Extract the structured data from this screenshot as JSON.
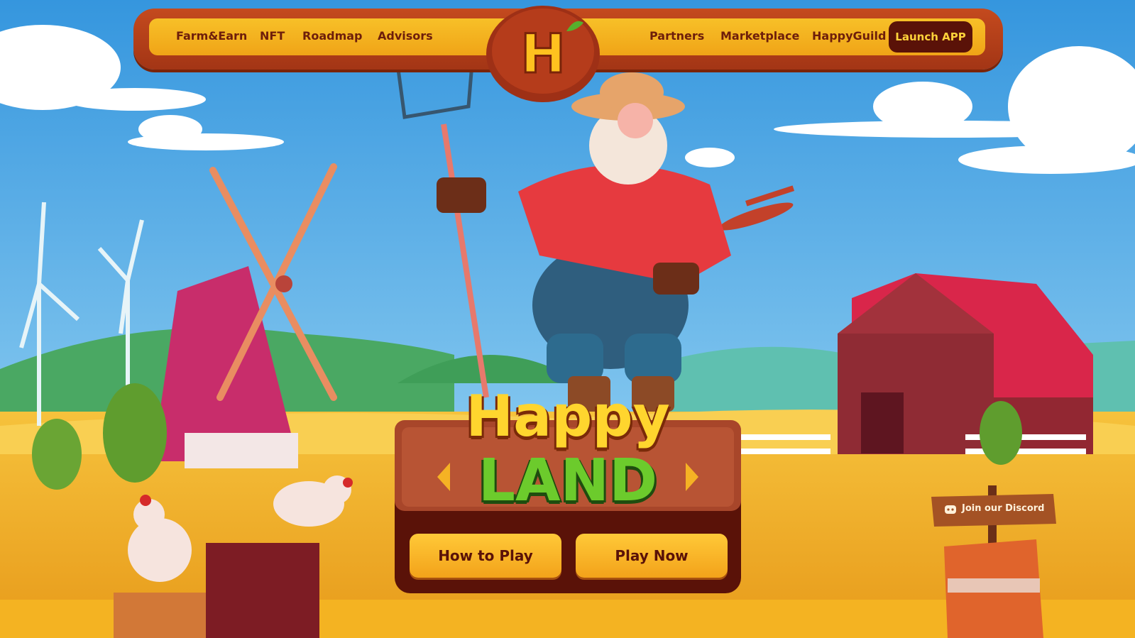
{
  "nav": {
    "left_links": [
      "Farm&Earn",
      "NFT",
      "Roadmap",
      "Advisors"
    ],
    "right_links": [
      "Partners",
      "Marketplace",
      "HappyGuild"
    ],
    "launch_label": "Launch APP",
    "logo_letter": "H"
  },
  "hero": {
    "title_top": "Happy",
    "title_bottom": "LAND",
    "how_to_play": "How to Play",
    "play_now": "Play Now"
  },
  "discord": {
    "label": "Join our Discord"
  },
  "colors": {
    "sky_top": "#3d9de0",
    "sky_bottom": "#9fd9f6",
    "field": "#f0b22a",
    "nav_brown": "#b23e17",
    "nav_gold": "#f5b51f",
    "button_gold": "#ffc134",
    "button_text": "#5a1208",
    "barn_red": "#d92c4a",
    "title_yellow": "#ffd52e",
    "title_green": "#6ccb2c"
  },
  "icons": [
    "logo-h-icon",
    "chevron-left-icon",
    "chevron-right-icon",
    "discord-icon"
  ]
}
